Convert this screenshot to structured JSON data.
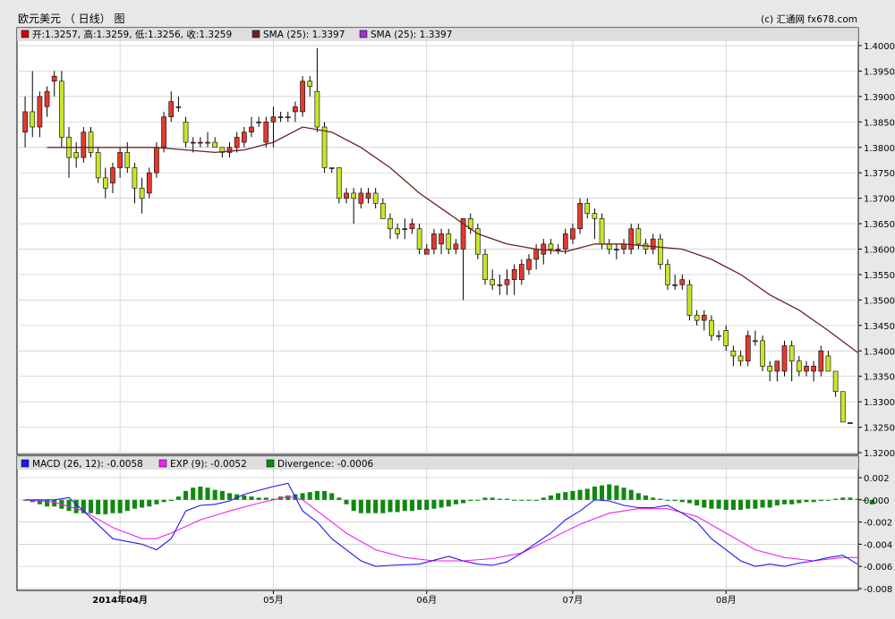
{
  "header": {
    "title": "欧元美元 （ 日线） 图",
    "copyright": "(c) 汇通网 fx678.com"
  },
  "legend_price": [
    {
      "text": "开:1.3257, 高:1.3259, 低:1.3256, 收:1.3259",
      "color": "#cc0000"
    },
    {
      "text": "SMA (25): 1.3397",
      "color": "#6b2222"
    },
    {
      "text": "SMA (25): 1.3397",
      "color": "#9933cc"
    }
  ],
  "legend_macd": [
    {
      "text": "MACD (26, 12): -0.0058",
      "color": "#1a1aee"
    },
    {
      "text": "EXP (9): -0.0052",
      "color": "#ee22ee"
    },
    {
      "text": "Divergence: -0.0006",
      "color": "#118811"
    }
  ],
  "colors": {
    "up": "#e23a2e",
    "down": "#c8e62c",
    "sma": "#6b2222",
    "macd": "#1a1aee",
    "signal": "#ee22ee",
    "hist": "#118811"
  },
  "chart_data": [
    {
      "type": "candlestick",
      "title": "欧元美元 （ 日线） 图",
      "x_tick_labels": [
        "2014年04月",
        "05月",
        "06月",
        "07月",
        "08月"
      ],
      "x_ticks_at_index": [
        13,
        34,
        55,
        75,
        96
      ],
      "ylim": [
        1.32,
        1.4
      ],
      "y_ticks": [
        "1.4000",
        "1.3950",
        "1.3900",
        "1.3850",
        "1.3800",
        "1.3750",
        "1.3700",
        "1.3650",
        "1.3600",
        "1.3550",
        "1.3500",
        "1.3450",
        "1.3400",
        "1.3350",
        "1.3300",
        "1.3250",
        "1.3200"
      ],
      "ohlc": [
        [
          1.383,
          1.39,
          1.38,
          1.387
        ],
        [
          1.387,
          1.395,
          1.382,
          1.384
        ],
        [
          1.384,
          1.391,
          1.382,
          1.39
        ],
        [
          1.388,
          1.392,
          1.386,
          1.391
        ],
        [
          1.393,
          1.395,
          1.39,
          1.394
        ],
        [
          1.393,
          1.395,
          1.38,
          1.382
        ],
        [
          1.382,
          1.384,
          1.374,
          1.378
        ],
        [
          1.379,
          1.381,
          1.376,
          1.378
        ],
        [
          1.378,
          1.384,
          1.377,
          1.383
        ],
        [
          1.383,
          1.384,
          1.378,
          1.379
        ],
        [
          1.379,
          1.38,
          1.373,
          1.374
        ],
        [
          1.374,
          1.376,
          1.37,
          1.372
        ],
        [
          1.373,
          1.377,
          1.371,
          1.376
        ],
        [
          1.376,
          1.38,
          1.374,
          1.379
        ],
        [
          1.379,
          1.381,
          1.375,
          1.376
        ],
        [
          1.376,
          1.377,
          1.369,
          1.372
        ],
        [
          1.372,
          1.374,
          1.367,
          1.37
        ],
        [
          1.371,
          1.376,
          1.37,
          1.375
        ],
        [
          1.375,
          1.381,
          1.374,
          1.38
        ],
        [
          1.38,
          1.387,
          1.379,
          1.386
        ],
        [
          1.386,
          1.391,
          1.385,
          1.389
        ],
        [
          1.388,
          1.39,
          1.387,
          1.388
        ],
        [
          1.385,
          1.386,
          1.38,
          1.381
        ],
        [
          1.381,
          1.382,
          1.379,
          1.381
        ],
        [
          1.381,
          1.382,
          1.38,
          1.381
        ],
        [
          1.381,
          1.383,
          1.38,
          1.381
        ],
        [
          1.381,
          1.382,
          1.38,
          1.38
        ],
        [
          1.38,
          1.38,
          1.378,
          1.379
        ],
        [
          1.379,
          1.381,
          1.378,
          1.38
        ],
        [
          1.38,
          1.383,
          1.379,
          1.382
        ],
        [
          1.381,
          1.384,
          1.38,
          1.383
        ],
        [
          1.383,
          1.386,
          1.382,
          1.384
        ],
        [
          1.385,
          1.386,
          1.384,
          1.385
        ],
        [
          1.381,
          1.386,
          1.38,
          1.385
        ],
        [
          1.385,
          1.388,
          1.38,
          1.386
        ],
        [
          1.386,
          1.387,
          1.385,
          1.386
        ],
        [
          1.386,
          1.387,
          1.385,
          1.386
        ],
        [
          1.387,
          1.389,
          1.385,
          1.388
        ],
        [
          1.387,
          1.394,
          1.386,
          1.393
        ],
        [
          1.393,
          1.394,
          1.39,
          1.392
        ],
        [
          1.391,
          1.3995,
          1.383,
          1.384
        ],
        [
          1.384,
          1.385,
          1.375,
          1.376
        ],
        [
          1.376,
          1.376,
          1.375,
          1.376
        ],
        [
          1.376,
          1.376,
          1.369,
          1.37
        ],
        [
          1.37,
          1.372,
          1.369,
          1.371
        ],
        [
          1.371,
          1.372,
          1.365,
          1.37
        ],
        [
          1.369,
          1.372,
          1.368,
          1.371
        ],
        [
          1.37,
          1.372,
          1.369,
          1.371
        ],
        [
          1.371,
          1.372,
          1.368,
          1.369
        ],
        [
          1.369,
          1.37,
          1.366,
          1.366
        ],
        [
          1.366,
          1.367,
          1.362,
          1.364
        ],
        [
          1.364,
          1.365,
          1.362,
          1.363
        ],
        [
          1.364,
          1.366,
          1.362,
          1.364
        ],
        [
          1.364,
          1.366,
          1.363,
          1.365
        ],
        [
          1.364,
          1.365,
          1.359,
          1.36
        ],
        [
          1.359,
          1.361,
          1.359,
          1.36
        ],
        [
          1.36,
          1.364,
          1.359,
          1.363
        ],
        [
          1.361,
          1.364,
          1.359,
          1.363
        ],
        [
          1.363,
          1.364,
          1.359,
          1.36
        ],
        [
          1.36,
          1.362,
          1.359,
          1.361
        ],
        [
          1.36,
          1.366,
          1.35,
          1.366
        ],
        [
          1.366,
          1.367,
          1.363,
          1.364
        ],
        [
          1.364,
          1.365,
          1.358,
          1.359
        ],
        [
          1.359,
          1.36,
          1.353,
          1.354
        ],
        [
          1.354,
          1.356,
          1.352,
          1.353
        ],
        [
          1.353,
          1.355,
          1.351,
          1.353
        ],
        [
          1.353,
          1.356,
          1.351,
          1.354
        ],
        [
          1.354,
          1.357,
          1.351,
          1.356
        ],
        [
          1.354,
          1.358,
          1.353,
          1.357
        ],
        [
          1.356,
          1.359,
          1.355,
          1.358
        ],
        [
          1.358,
          1.361,
          1.356,
          1.36
        ],
        [
          1.359,
          1.362,
          1.357,
          1.361
        ],
        [
          1.361,
          1.362,
          1.359,
          1.36
        ],
        [
          1.36,
          1.361,
          1.359,
          1.36
        ],
        [
          1.36,
          1.364,
          1.359,
          1.363
        ],
        [
          1.362,
          1.365,
          1.361,
          1.364
        ],
        [
          1.364,
          1.37,
          1.363,
          1.369
        ],
        [
          1.369,
          1.37,
          1.366,
          1.367
        ],
        [
          1.367,
          1.368,
          1.362,
          1.366
        ],
        [
          1.366,
          1.367,
          1.36,
          1.361
        ],
        [
          1.361,
          1.362,
          1.359,
          1.36
        ],
        [
          1.36,
          1.361,
          1.358,
          1.36
        ],
        [
          1.36,
          1.362,
          1.359,
          1.361
        ],
        [
          1.36,
          1.365,
          1.359,
          1.364
        ],
        [
          1.364,
          1.365,
          1.36,
          1.361
        ],
        [
          1.361,
          1.362,
          1.359,
          1.36
        ],
        [
          1.36,
          1.363,
          1.359,
          1.362
        ],
        [
          1.362,
          1.363,
          1.356,
          1.357
        ],
        [
          1.357,
          1.358,
          1.352,
          1.353
        ],
        [
          1.353,
          1.355,
          1.352,
          1.353
        ],
        [
          1.353,
          1.355,
          1.352,
          1.354
        ],
        [
          1.353,
          1.354,
          1.346,
          1.347
        ],
        [
          1.347,
          1.348,
          1.345,
          1.346
        ],
        [
          1.346,
          1.348,
          1.344,
          1.347
        ],
        [
          1.346,
          1.347,
          1.342,
          1.343
        ],
        [
          1.343,
          1.344,
          1.342,
          1.343
        ],
        [
          1.344,
          1.345,
          1.34,
          1.341
        ],
        [
          1.34,
          1.341,
          1.337,
          1.339
        ],
        [
          1.339,
          1.34,
          1.337,
          1.338
        ],
        [
          1.338,
          1.344,
          1.337,
          1.343
        ],
        [
          1.342,
          1.344,
          1.341,
          1.342
        ],
        [
          1.342,
          1.343,
          1.336,
          1.337
        ],
        [
          1.337,
          1.338,
          1.334,
          1.336
        ],
        [
          1.336,
          1.338,
          1.334,
          1.338
        ],
        [
          1.336,
          1.342,
          1.335,
          1.341
        ],
        [
          1.341,
          1.342,
          1.334,
          1.338
        ],
        [
          1.338,
          1.339,
          1.335,
          1.336
        ],
        [
          1.336,
          1.338,
          1.335,
          1.337
        ],
        [
          1.336,
          1.338,
          1.334,
          1.337
        ],
        [
          1.336,
          1.341,
          1.335,
          1.34
        ],
        [
          1.339,
          1.34,
          1.336,
          1.336
        ],
        [
          1.336,
          1.336,
          1.331,
          1.332
        ],
        [
          1.332,
          1.332,
          1.326,
          1.326
        ],
        [
          1.3257,
          1.3259,
          1.3256,
          1.3259
        ]
      ],
      "sma25": {
        "name": "SMA (25)",
        "x": [
          3,
          8,
          13,
          18,
          22,
          26,
          30,
          34,
          38,
          42,
          46,
          50,
          54,
          58,
          62,
          66,
          70,
          74,
          78,
          82,
          86,
          90,
          94,
          98,
          102,
          106,
          110,
          114
        ],
        "y": [
          1.38,
          1.38,
          1.38,
          1.38,
          1.3795,
          1.379,
          1.3795,
          1.381,
          1.384,
          1.383,
          1.38,
          1.376,
          1.371,
          1.367,
          1.363,
          1.361,
          1.36,
          1.3595,
          1.361,
          1.361,
          1.3605,
          1.36,
          1.358,
          1.355,
          1.351,
          1.348,
          1.344,
          1.3397
        ]
      }
    },
    {
      "type": "line+bar",
      "title": "MACD (26, 12)",
      "ylim": [
        -0.008,
        0.002
      ],
      "y_ticks": [
        "0.002",
        "0.000",
        "-0.002",
        "-0.004",
        "-0.006",
        "-0.008"
      ],
      "series": [
        {
          "name": "MACD (26, 12)",
          "x": [
            0,
            4,
            6,
            8,
            12,
            16,
            18,
            20,
            22,
            24,
            26,
            28,
            30,
            34,
            36,
            38,
            40,
            42,
            44,
            46,
            48,
            50,
            54,
            58,
            60,
            62,
            64,
            66,
            68,
            72,
            74,
            76,
            78,
            80,
            82,
            84,
            86,
            88,
            90,
            92,
            94,
            96,
            98,
            100,
            102,
            104,
            106,
            108,
            110,
            112,
            114
          ],
          "y": [
            0.0,
            0.0,
            0.0002,
            -0.001,
            -0.0035,
            -0.004,
            -0.0045,
            -0.0035,
            -0.001,
            -0.0005,
            -0.0004,
            -0.0001,
            0.0005,
            0.0012,
            0.0015,
            -0.001,
            -0.002,
            -0.0035,
            -0.0045,
            -0.0055,
            -0.006,
            -0.0059,
            -0.0058,
            -0.0051,
            -0.0055,
            -0.0058,
            -0.0059,
            -0.0056,
            -0.0048,
            -0.003,
            -0.0018,
            -0.001,
            0.0,
            -0.0001,
            -0.0005,
            -0.0007,
            -0.0007,
            -0.0005,
            -0.0012,
            -0.002,
            -0.0035,
            -0.0045,
            -0.0055,
            -0.006,
            -0.0058,
            -0.006,
            -0.0057,
            -0.0055,
            -0.0052,
            -0.005,
            -0.0058
          ]
        },
        {
          "name": "EXP (9)",
          "x": [
            0,
            4,
            8,
            12,
            16,
            18,
            20,
            24,
            28,
            32,
            36,
            38,
            40,
            44,
            48,
            52,
            56,
            60,
            64,
            68,
            72,
            76,
            80,
            84,
            88,
            92,
            96,
            100,
            104,
            108,
            112,
            114
          ],
          "y": [
            0.0,
            -0.0002,
            -0.001,
            -0.0025,
            -0.0035,
            -0.0035,
            -0.003,
            -0.0018,
            -0.001,
            -0.0003,
            0.0003,
            0.0,
            -0.001,
            -0.003,
            -0.0045,
            -0.0052,
            -0.0055,
            -0.0055,
            -0.0053,
            -0.0048,
            -0.0035,
            -0.0022,
            -0.0012,
            -0.0008,
            -0.0008,
            -0.0015,
            -0.003,
            -0.0045,
            -0.0052,
            -0.0055,
            -0.0052,
            -0.0052
          ]
        },
        {
          "name": "Divergence",
          "values": [
            0.0,
            -0.0002,
            -0.0004,
            -0.0006,
            -0.0006,
            -0.0008,
            -0.001,
            -0.0012,
            -0.0012,
            -0.0012,
            -0.0013,
            -0.0013,
            -0.0012,
            -0.0012,
            -0.001,
            -0.0008,
            -0.0007,
            -0.0006,
            -0.0004,
            -0.0002,
            -0.0001,
            0.0003,
            0.0008,
            0.0011,
            0.0012,
            0.0011,
            0.0009,
            0.0008,
            0.0006,
            0.0005,
            0.0004,
            0.0003,
            0.0002,
            0.0002,
            0.0001,
            0.0003,
            0.0004,
            0.0005,
            0.0006,
            0.0007,
            0.0008,
            0.0008,
            0.0006,
            0.0002,
            -0.0004,
            -0.001,
            -0.0012,
            -0.0012,
            -0.0012,
            -0.0012,
            -0.0011,
            -0.0011,
            -0.001,
            -0.001,
            -0.0009,
            -0.0009,
            -0.0008,
            -0.0007,
            -0.0006,
            -0.0004,
            -0.0003,
            -0.0001,
            0.0,
            0.0002,
            0.0002,
            0.0001,
            0.0001,
            0.0,
            0.0,
            0.0,
            0.0,
            0.0002,
            0.0004,
            0.0006,
            0.0007,
            0.0008,
            0.0009,
            0.001,
            0.0012,
            0.0013,
            0.0014,
            0.0013,
            0.0011,
            0.0009,
            0.0006,
            0.0004,
            0.0002,
            0.0001,
            0.0,
            -0.0001,
            -0.0002,
            -0.0003,
            -0.0005,
            -0.0007,
            -0.0008,
            -0.0008,
            -0.0009,
            -0.0009,
            -0.0009,
            -0.0008,
            -0.0008,
            -0.0007,
            -0.0007,
            -0.0005,
            -0.0004,
            -0.0004,
            -0.0003,
            -0.0002,
            -0.0002,
            -0.0001,
            0.0,
            0.0001,
            0.0002,
            0.0002,
            0.0001,
            -0.0001,
            -0.0004
          ]
        }
      ]
    }
  ]
}
